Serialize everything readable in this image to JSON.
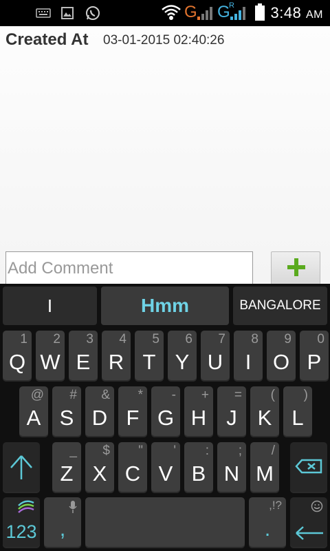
{
  "status_bar": {
    "time": "3:48",
    "ampm": "AM",
    "network_1": "G",
    "network_2": "G",
    "roaming": "R",
    "icons": [
      "keyboard-icon",
      "image-icon",
      "whatsapp-icon",
      "wifi-icon",
      "signal-icon",
      "battery-icon"
    ]
  },
  "record": {
    "created_label": "Created At",
    "created_value": "03-01-2015 02:40:26"
  },
  "comment": {
    "placeholder": "Add Comment",
    "add_button": "+"
  },
  "keyboard": {
    "suggestions": [
      "I",
      "Hmm",
      "BANGALORE"
    ],
    "row1": [
      {
        "main": "Q",
        "sub": "1"
      },
      {
        "main": "W",
        "sub": "2"
      },
      {
        "main": "E",
        "sub": "3"
      },
      {
        "main": "R",
        "sub": "4"
      },
      {
        "main": "T",
        "sub": "5"
      },
      {
        "main": "Y",
        "sub": "6"
      },
      {
        "main": "U",
        "sub": "7"
      },
      {
        "main": "I",
        "sub": "8"
      },
      {
        "main": "O",
        "sub": "9"
      },
      {
        "main": "P",
        "sub": "0"
      }
    ],
    "row2": [
      {
        "main": "A",
        "sub": "@"
      },
      {
        "main": "S",
        "sub": "#"
      },
      {
        "main": "D",
        "sub": "&"
      },
      {
        "main": "F",
        "sub": "*"
      },
      {
        "main": "G",
        "sub": "-"
      },
      {
        "main": "H",
        "sub": "+"
      },
      {
        "main": "J",
        "sub": "="
      },
      {
        "main": "K",
        "sub": "("
      },
      {
        "main": "L",
        "sub": ")"
      }
    ],
    "row3": [
      {
        "main": "Z",
        "sub": "_"
      },
      {
        "main": "X",
        "sub": "$"
      },
      {
        "main": "C",
        "sub": "\""
      },
      {
        "main": "V",
        "sub": "'"
      },
      {
        "main": "B",
        "sub": ":"
      },
      {
        "main": "N",
        "sub": ";"
      },
      {
        "main": "M",
        "sub": "/"
      }
    ],
    "numbers_key": "123",
    "comma_key": ",",
    "period_key": ".",
    "punct_hint": ",!?",
    "accent_color": "#5cc8d6"
  }
}
